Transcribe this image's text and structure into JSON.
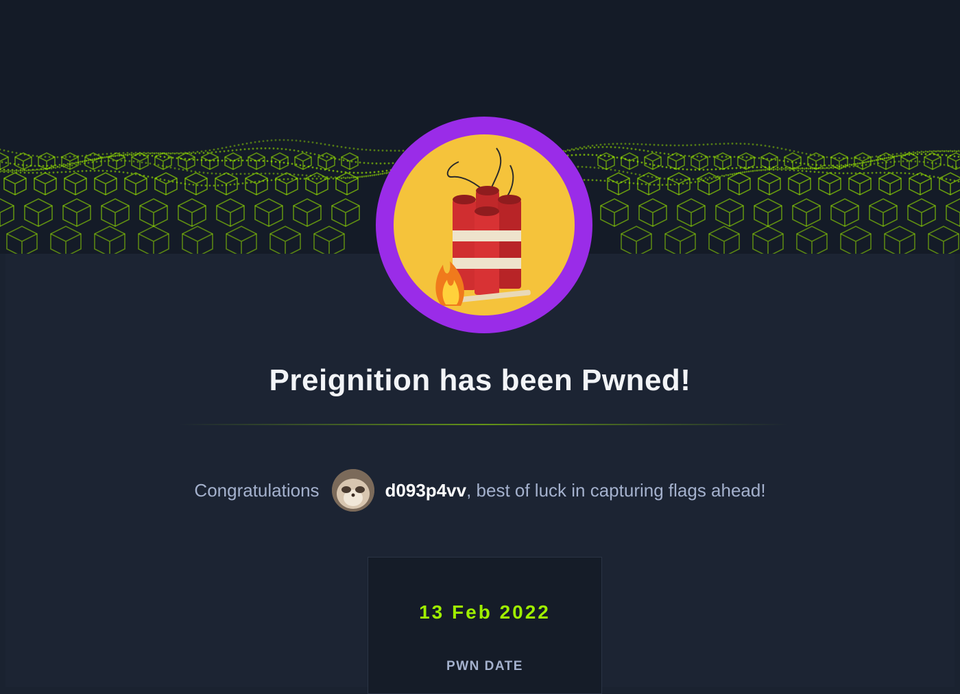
{
  "banner": {
    "accent_color": "#9fef00",
    "style": "green wireframe cube grid"
  },
  "badge": {
    "ring_color": "#9a2ce8",
    "fill_color": "#f5c33b",
    "icon": "dynamite-icon"
  },
  "header": {
    "title": "Preignition has been Pwned!"
  },
  "congrats": {
    "prefix": "Congratulations",
    "username": "d093p4vv",
    "suffix": ", best of luck in capturing flags ahead!",
    "avatar_icon": "user-avatar"
  },
  "pwn_card": {
    "date": "13 Feb 2022",
    "label": "PWN DATE"
  }
}
